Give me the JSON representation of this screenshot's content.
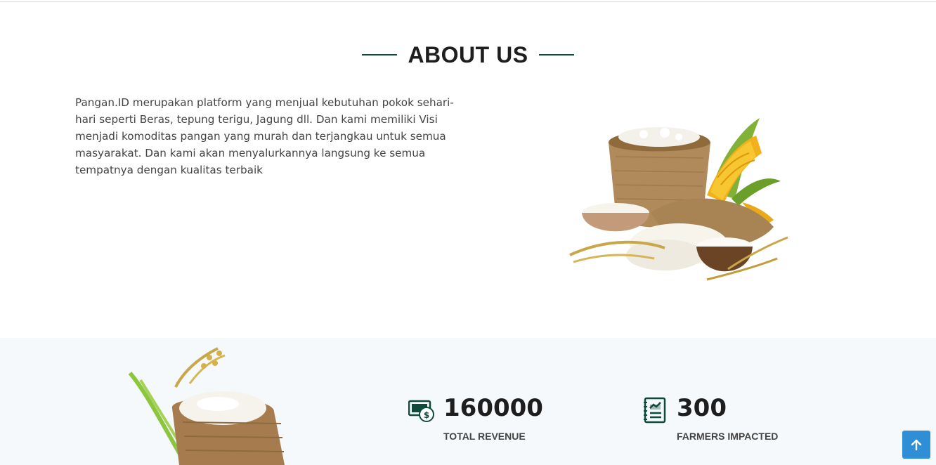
{
  "about": {
    "title": "ABOUT US",
    "description": "Pangan.ID merupakan platform yang menjual kebutuhan pokok sehari-hari seperti Beras, tepung terigu, Jagung dll. Dan kami memiliki Visi menjadi komoditas pangan yang murah dan terjangkau untuk semua masyarakat. Dan kami akan menyalurkannya langsung ke semua tempatnya dengan kualitas terbaik"
  },
  "stats": [
    {
      "value": "160000",
      "label": "TOTAL REVENUE",
      "icon": "money-icon"
    },
    {
      "value": "300",
      "label": "FARMERS IMPACTED",
      "icon": "report-icon"
    }
  ],
  "colors": {
    "accent": "#0f4a3a",
    "stats_bg": "#f5f9fb",
    "scroll_button": "#2f8fd6"
  },
  "scroll_top": {
    "icon": "arrow-up-icon"
  }
}
